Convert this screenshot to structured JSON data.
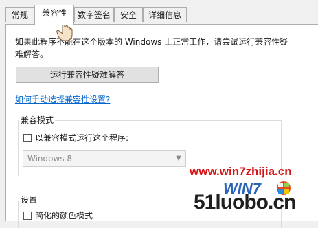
{
  "tabs": [
    {
      "label": "常规"
    },
    {
      "label": "兼容性"
    },
    {
      "label": "数字签名"
    },
    {
      "label": "安全"
    },
    {
      "label": "详细信息"
    }
  ],
  "description": "如果此程序不能在这个版本的 Windows 上正常工作，请尝试运行兼容性疑难解答。",
  "troubleshoot_button": "运行兼容性疑难解答",
  "manual_link": "如何手动选择兼容性设置?",
  "compat_mode": {
    "title": "兼容模式",
    "checkbox_label": "以兼容模式运行这个程序:",
    "select_value": "Windows 8"
  },
  "settings": {
    "title": "设置",
    "reduced_color_label": "简化的颜色模式"
  },
  "watermark": {
    "site": "www.win7zhijia.cn",
    "brand": "51luobo.cn"
  }
}
